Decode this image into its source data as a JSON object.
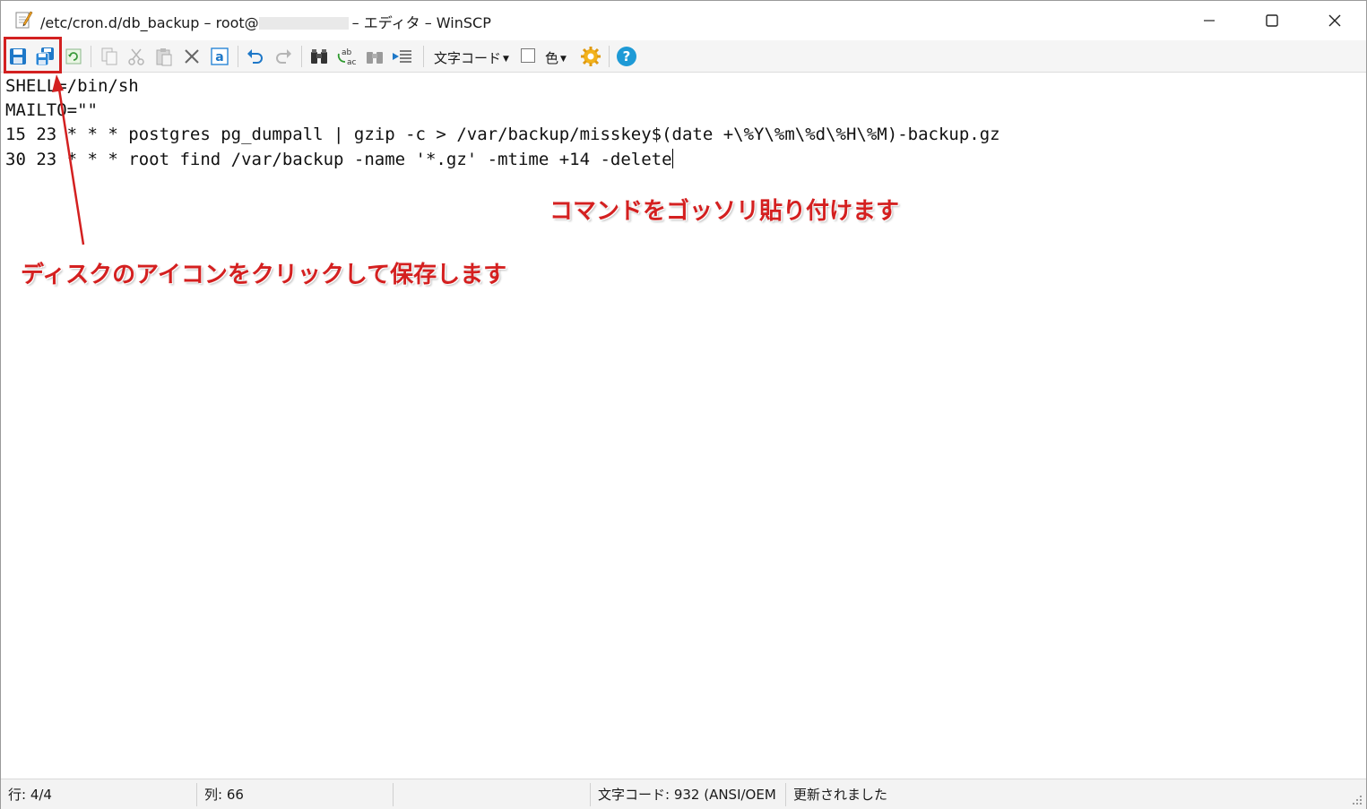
{
  "window": {
    "title_prefix": "/etc/cron.d/db_backup – root@",
    "title_suffix": "– エディタ – WinSCP"
  },
  "toolbar": {
    "encoding_label": "文字コード",
    "color_label": "色",
    "icons": [
      "save-icon",
      "save-all-icon",
      "reload-icon",
      "copy-icon",
      "cut-icon",
      "paste-icon",
      "delete-icon",
      "select-all-icon",
      "undo-icon",
      "redo-icon",
      "find-icon",
      "replace-icon",
      "find-next-icon",
      "goto-line-icon",
      "settings-icon",
      "help-icon"
    ]
  },
  "editor": {
    "lines": [
      "SHELL=/bin/sh",
      "MAILTO=\"\"",
      "15 23 * * * postgres pg_dumpall | gzip -c > /var/backup/misskey$(date +\\%Y\\%m\\%d\\%H\\%M)-backup.gz",
      "30 23 * * * root find /var/backup -name '*.gz' -mtime +14 -delete"
    ]
  },
  "annotations": {
    "paste_note": "コマンドをゴッソリ貼り付けます",
    "save_note": "ディスクのアイコンをクリックして保存します",
    "color": "#d42020"
  },
  "status": {
    "line": "行: 4/4",
    "column": "列: 66",
    "encoding": "文字コード: 932 (ANSI/OEM",
    "modified": "更新されました"
  }
}
